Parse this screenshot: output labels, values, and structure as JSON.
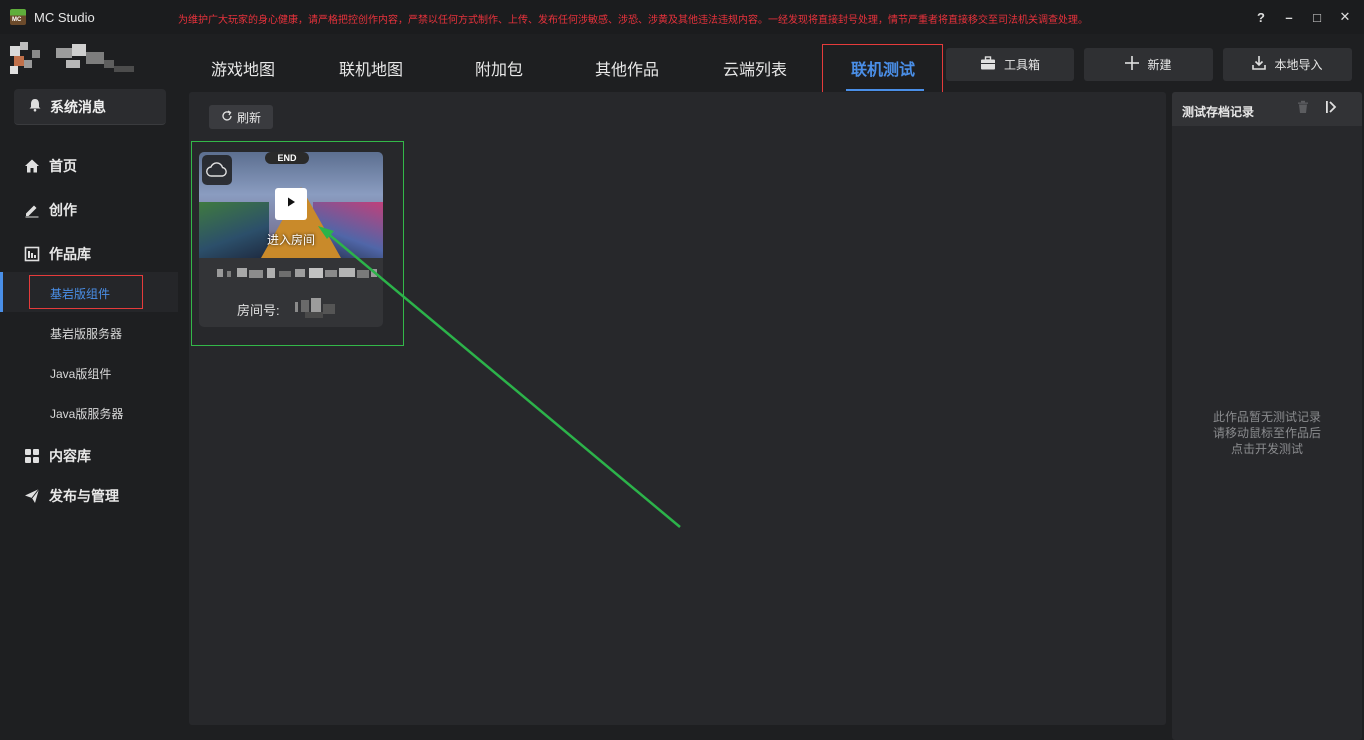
{
  "window": {
    "app_title": "MC Studio",
    "notice": "为维护广大玩家的身心健康，请严格把控创作内容，严禁以任何方式制作、上传、发布任何涉敏感、涉恐、涉黄及其他违法违规内容。一经发现将直接封号处理，情节严重者将直接移交至司法机关调查处理。",
    "buttons": [
      "?",
      "–",
      "□",
      "✕"
    ]
  },
  "sidebar": {
    "system_message": "系统消息",
    "nav": [
      {
        "label": "首页",
        "icon": "home-icon"
      },
      {
        "label": "创作",
        "icon": "pencil-icon"
      },
      {
        "label": "作品库",
        "icon": "library-icon"
      }
    ],
    "sub_items": [
      {
        "label": "基岩版组件",
        "active": true
      },
      {
        "label": "基岩版服务器",
        "active": false
      },
      {
        "label": "Java版组件",
        "active": false
      },
      {
        "label": "Java版服务器",
        "active": false
      }
    ],
    "nav_bottom": [
      {
        "label": "内容库",
        "icon": "grid-icon"
      },
      {
        "label": "发布与管理",
        "icon": "send-icon"
      }
    ]
  },
  "tabs": [
    {
      "label": "游戏地图",
      "active": false
    },
    {
      "label": "联机地图",
      "active": false
    },
    {
      "label": "附加包",
      "active": false
    },
    {
      "label": "其他作品",
      "active": false
    },
    {
      "label": "云端列表",
      "active": false
    },
    {
      "label": "联机测试",
      "active": true
    }
  ],
  "toolbar": {
    "toolbox": "工具箱",
    "new": "新建",
    "import": "本地导入"
  },
  "main": {
    "refresh": "刷新",
    "card": {
      "thumb_sign": "END",
      "enter_room": "进入房间",
      "room_label": "房间号:"
    }
  },
  "right_panel": {
    "title": "测试存档记录",
    "empty_lines": [
      "此作品暂无测试记录",
      "请移动鼠标至作品后",
      "点击开发测试"
    ]
  },
  "colors": {
    "accent": "#4a8fe8",
    "highlight_red": "#e53b3b",
    "highlight_green": "#33b849",
    "notice_red": "#e8323c"
  }
}
